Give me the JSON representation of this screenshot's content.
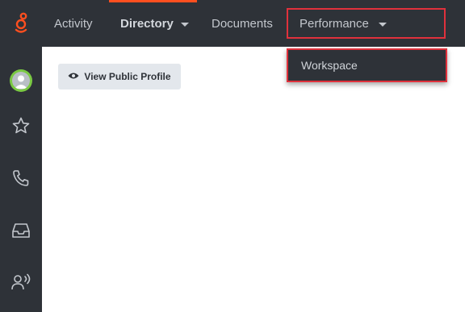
{
  "nav": {
    "items": [
      {
        "label": "Activity"
      },
      {
        "label": "Directory"
      },
      {
        "label": "Documents"
      },
      {
        "label": "Performance"
      }
    ]
  },
  "dropdown": {
    "items": [
      {
        "label": "Workspace"
      }
    ]
  },
  "profile_button": {
    "label": "View Public Profile"
  },
  "sidebar": {
    "icons": [
      "avatar",
      "star-icon",
      "phone-icon",
      "inbox-icon",
      "user-voice-icon"
    ]
  },
  "colors": {
    "nav_bg": "#2e3238",
    "accent": "#ff4f1f",
    "highlight": "#e0313c",
    "presence": "#7ac943"
  }
}
